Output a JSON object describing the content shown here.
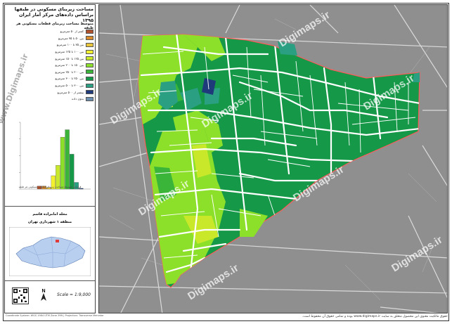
{
  "legend": {
    "title": "مساحت زیربنای مسکونی در طبقها",
    "title_line2": "براساس داده‌های مرکز آمار ایران ۱۳۹۵",
    "subtitle": "متوسط مساحت زیربنای قطعات مسکونی هر طبقه",
    "items": [
      {
        "label": "کمتر از ۵۰ مترمربع",
        "color": "#b0522e"
      },
      {
        "label": "بین ۵۰ تا ۷۵ مترمربع",
        "color": "#d98a2a"
      },
      {
        "label": "بین ۷۵ تا ۱۰۰ مترمربع",
        "color": "#e9c53a"
      },
      {
        "label": "بین ۱۰۰ تا ۱۲۵ مترمربع",
        "color": "#f2ef2f"
      },
      {
        "label": "بین ۱۲۵ تا ۱۵۰ مترمربع",
        "color": "#c9e82a"
      },
      {
        "label": "بین ۱۵۰ تا ۲۰۰ مترمربع",
        "color": "#8de02a"
      },
      {
        "label": "بین ۲۰۰ تا ۲۵۰ مترمربع",
        "color": "#3ab53a"
      },
      {
        "label": "بین ۲۵۰ تا ۳۰۰ مترمربع",
        "color": "#159848"
      },
      {
        "label": "بین ۳۰۰ تا ۵۰۰ مترمربع",
        "color": "#2a9f82"
      },
      {
        "label": "بیشتر از ۵۰۰ مترمربع",
        "color": "#1f3a7a"
      },
      {
        "label": "بدون داده",
        "color": "#6c8fb0"
      }
    ],
    "histogram_note": "فراوانی متوسط مساحت زیربنای قطعات مسکونی هر طبقه"
  },
  "histogram": {
    "type": "bar",
    "values": [
      4,
      4,
      2,
      18,
      32,
      70,
      80,
      47,
      9,
      1
    ],
    "colors": [
      "#b0522e",
      "#d98a2a",
      "#e9c53a",
      "#f2ef2f",
      "#c9e82a",
      "#8de02a",
      "#3ab53a",
      "#159848",
      "#2a9f82",
      "#1f3a7a"
    ],
    "ylim": [
      0,
      90
    ]
  },
  "region": {
    "neighborhood": "محله امامزاده قاسم",
    "district": "منطقه ۱ شهرداری تهران"
  },
  "scale": "Scale = 1:9,000",
  "watermark": "Digimaps.ir",
  "side_watermark": "www.Digimaps.ir",
  "footer": "حقوق مالکیت معنوی این محصول متعلق به سایت www.digimaps.ir بوده و تمامی حقوق آن محفوظ است.",
  "footer_left": "Coordinate System: WGS 1984 UTM Zone 39N | Projection: Transverse Mercator"
}
